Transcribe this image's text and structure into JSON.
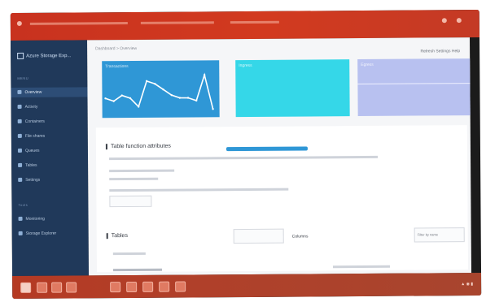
{
  "sidebar": {
    "brand": "Azure Storage Exp...",
    "items": [
      {
        "label": "Overview",
        "icon": "home-icon"
      },
      {
        "label": "Activity",
        "icon": "activity-icon"
      },
      {
        "label": "Containers",
        "icon": "container-icon"
      },
      {
        "label": "File shares",
        "icon": "file-icon"
      },
      {
        "label": "Queues",
        "icon": "queue-icon"
      },
      {
        "label": "Tables",
        "icon": "table-icon"
      },
      {
        "label": "Settings",
        "icon": "settings-icon"
      }
    ],
    "section2_title": "Tools",
    "section2_items": [
      {
        "label": "Monitoring",
        "icon": "monitor-icon"
      },
      {
        "label": "Storage Explorer",
        "icon": "explorer-icon"
      }
    ]
  },
  "main": {
    "breadcrumb": "Dashboard > Overview",
    "top_right": "Refresh   Settings   Help",
    "cards": [
      {
        "title": "Transactions",
        "subtitle": ""
      },
      {
        "title": "Ingress",
        "subtitle": ""
      },
      {
        "title": "Egress",
        "subtitle": ""
      }
    ],
    "section_title": "Table function attributes",
    "section2_title": "Tables",
    "section2_right": "Filter by name",
    "section2_mid": "Columns"
  },
  "chart_data": {
    "type": "line",
    "values": [
      10,
      9,
      11,
      10,
      7,
      16,
      15,
      13,
      11,
      10,
      10,
      9,
      18,
      6
    ]
  }
}
